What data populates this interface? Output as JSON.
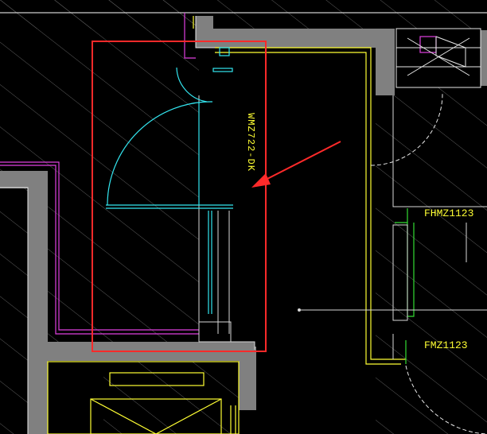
{
  "drawing": {
    "labels": {
      "door_tag": "WMZ722-DK",
      "fire_door_1": "FHMZ1123",
      "fire_door_2": "FMZ1123"
    },
    "colors": {
      "background": "#000000",
      "wall_fill": "#808080",
      "hatch": "#5a5a5a",
      "cyan_line": "#33e6f0",
      "magenta_line": "#e040e0",
      "yellow_line": "#ffff33",
      "green_line": "#33dd33",
      "white_line": "#ffffff",
      "highlight_box": "#ff2a2a",
      "annotation_arrow": "#ff2a2a"
    },
    "icons": [
      "door-swing-arc",
      "red-highlight-box",
      "red-arrow"
    ]
  }
}
